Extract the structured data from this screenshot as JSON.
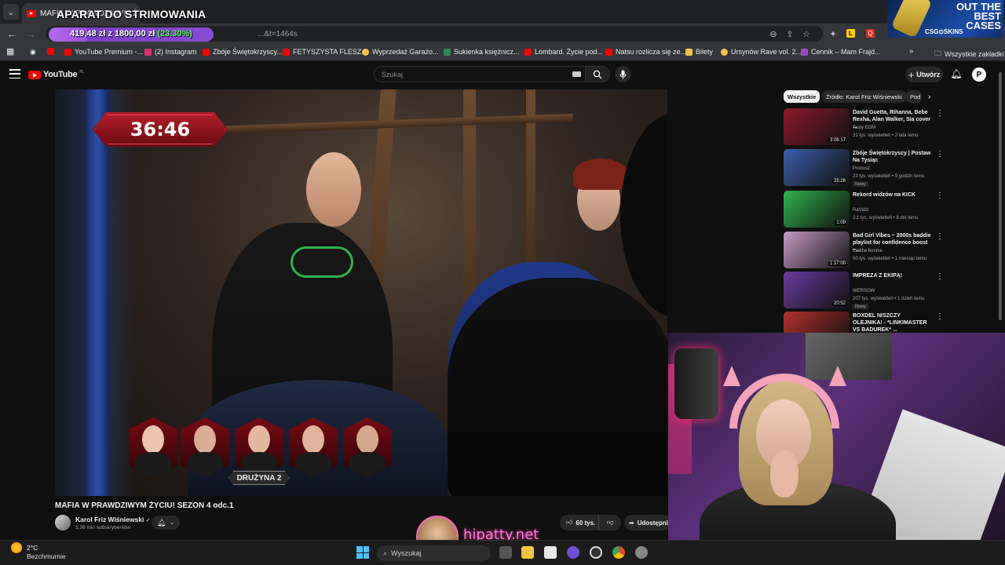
{
  "browser": {
    "tab_title": "MAFIA W PRAWDZIWYM Ż",
    "url": "...&t=1464s",
    "bookmarks": [
      {
        "label": "YouTube Premium -...",
        "color": "#ff0000"
      },
      {
        "label": "(2) Instagram",
        "color": "#e1306c"
      },
      {
        "label": "Zbóje Świętokrzyscy...",
        "color": "#ff0000"
      },
      {
        "label": "FETYSZYSTA FLESZ...",
        "color": "#ff0000"
      },
      {
        "label": "Wyprzedaż Garażo...",
        "color": "#f4c542"
      },
      {
        "label": "Sukienka księżnicz...",
        "color": "#2e8b57"
      },
      {
        "label": "Lombard. Życie pod...",
        "color": "#ff0000"
      },
      {
        "label": "Natsu rozlicza się ze...",
        "color": "#ff0000"
      },
      {
        "label": "Bilety",
        "color": "#f4c542"
      },
      {
        "label": "Ursynów Rave vol. 2...",
        "color": "#f4c542"
      },
      {
        "label": "Cennik – Mam Frajd...",
        "color": "#9a4dcc"
      }
    ],
    "all_bookmarks_label": "Wszystkie zakładki"
  },
  "overlay": {
    "stream_title": "APARAT DO STRIMOWANIA",
    "goal_amount": "419,48 zł z 1800,00 zł",
    "goal_percent": "(23.30%)",
    "goal_progress": 0.233,
    "ad_text_1": "OUT THE BEST CASES",
    "ad_brand": "CSG⊙SKINS",
    "hipatty": "hipatty.net"
  },
  "youtube": {
    "logo": "YouTube",
    "logo_region": "PL",
    "search_placeholder": "Szukaj",
    "create_label": "Utwórz",
    "avatar_letter": "P"
  },
  "player": {
    "timer": "36:46",
    "team_label": "DRUŻYNA 2"
  },
  "video": {
    "title": "MAFIA W PRAWDZIWYM ŻYCIU! SEZON 4 odc.1",
    "channel": "Karol Friz Wiśniewski",
    "subscribers": "3,36 mln subskrybentów",
    "likes": "60 tys.",
    "share": "Udostępnij"
  },
  "sidebar": {
    "chips": [
      "Wszystkie",
      "Źródło: Karol Friz Wiśniewski",
      "Pod"
    ],
    "recommendations": [
      {
        "title": "David Guetta, Rihanna, Bebe Rexha, Alan Walker, Sia cover ...",
        "channel": "Tasty EDM",
        "meta": "31 tys. wyświetleń • 2 lata temu",
        "duration": "3:06:17",
        "new": "",
        "thumb": "#8b1a2b"
      },
      {
        "title": "Zbóje Świętokrzyscy | Postaw Na Tysiąc",
        "channel": "Pronosz",
        "meta": "22 tys. wyświetleń • 9 godzin temu",
        "duration": "25:26",
        "new": "Nowy",
        "thumb": "#3a5ea8"
      },
      {
        "title": "Rekord widzów na KICK",
        "channel": "RaVidzi",
        "meta": "2,1 tys. wyświetleń • 8 dni temu",
        "duration": "1:09",
        "new": "",
        "thumb": "#2fb34a"
      },
      {
        "title": "Bad Girl Vibes ~ 2000s baddie playlist for confidence boost ~...",
        "channel": "baddie femme",
        "meta": "50 tys. wyświetleń • 1 miesiąc temu",
        "duration": "1:17:00",
        "new": "",
        "thumb": "#c89ac6"
      },
      {
        "title": "IMPREZA Z EKIPĄ!",
        "channel": "WERSOW",
        "meta": "207 tys. wyświetleń • 1 dzień temu",
        "duration": "20:52",
        "new": "Nowy",
        "thumb": "#6b3aa0"
      },
      {
        "title": "BOXDEL NISZCZY OLEJNIKA! - *LINKIMASTER VS BADUREK* ...",
        "channel": "",
        "meta": "",
        "duration": "",
        "new": "",
        "thumb": "#b0312a"
      }
    ]
  },
  "taskbar": {
    "temperature": "2°C",
    "weather": "Bezchmurnie",
    "search": "Wyszukaj"
  }
}
